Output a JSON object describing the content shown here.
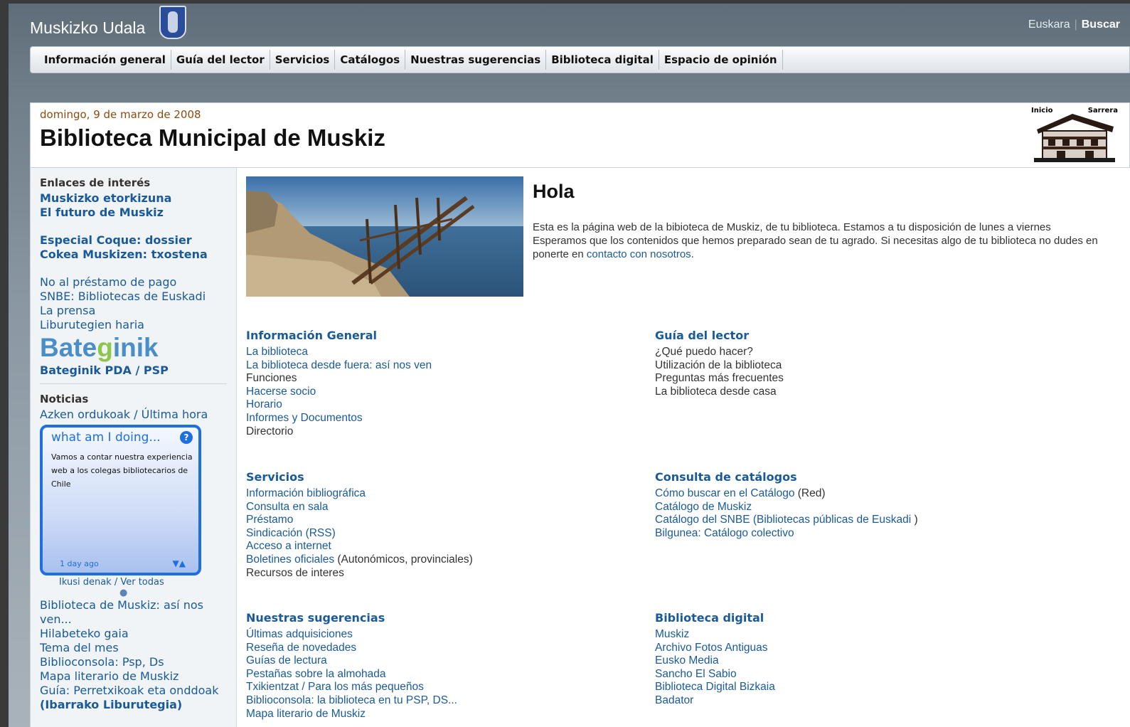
{
  "site": {
    "title": "Muskizko Udala"
  },
  "lang": {
    "euskara": "Euskara",
    "buscar": "Buscar"
  },
  "nav": [
    "Información general",
    "Guía del lector",
    "Servicios",
    "Catálogos",
    "Nuestras sugerencias",
    "Biblioteca digital",
    "Espacio de opinión"
  ],
  "header": {
    "date": "domingo, 9 de marzo de 2008",
    "heading": "Biblioteca Municipal de Muskiz",
    "logo_left": "Inicio",
    "logo_right": "Sarrera"
  },
  "sidebar": {
    "links_heading": "Enlaces de interés",
    "bold_links_1": [
      "Muskizko etorkizuna",
      "El futuro de Muskiz"
    ],
    "bold_links_2": [
      "Especial Coque: dossier",
      "Cokea Muskizen: txostena"
    ],
    "links": [
      "No al préstamo de pago",
      "SNBE: Bibliotecas de Euskadi",
      "La prensa",
      "Liburutegien haria"
    ],
    "bateginik_logo": "Bateginik",
    "bateginik_pda": "Bateginik PDA / PSP",
    "news_heading": "Noticias",
    "news_sub": "Azken ordukoak / Última hora",
    "widget": {
      "title": "what am I doing...",
      "help": "?",
      "message": "Vamos a contar nuestra experiencia web a los colegas bibliotecarios de Chile",
      "time": "1 day ago",
      "arrows": "▼▲"
    },
    "ver_todas": "Ikusi denak / Ver todas",
    "news_items": [
      "Biblioteca de Muskiz: así nos ven...",
      "Hilabeteko gaia",
      "Tema del mes",
      "Biblioconsola: Psp, Ds",
      "Mapa literario de Muskiz",
      "Guía: Perretxikoak eta onddoak"
    ],
    "news_last": "(Ibarrako Liburutegia)"
  },
  "main": {
    "hola": "Hola",
    "intro_text": "Esta es la página web de la bibioteca de Muskiz, de tu biblioteca. Estamos a tu disposición de lunes a viernes Esperamos que los contenidos que hemos preparado sean de tu agrado. Si necesitas algo de tu biblioteca no dudes en ponerte en ",
    "intro_link": "contacto con nosotros",
    "intro_end": ".",
    "info_general": {
      "title": "Información General",
      "items": [
        "La biblioteca",
        "La biblioteca desde fuera: así nos ven",
        "Funciones",
        "Hacerse socio",
        "Horario",
        "Informes y Documentos",
        "Directorio"
      ]
    },
    "guia": {
      "title": "Guía del lector",
      "items": [
        "¿Qué puedo hacer?",
        "Utilización de la biblioteca",
        "Preguntas más frecuentes",
        "La biblioteca desde casa"
      ]
    },
    "servicios": {
      "title": "Servicios",
      "items": [
        "Información bibliográfica",
        "Consulta en sala",
        "Préstamo",
        "Sindicación (RSS)",
        "Acceso a internet"
      ],
      "boletines_link": "Boletines oficiales",
      "boletines_rest": " (Autonómicos, provinciales)",
      "recursos": "Recursos de interes"
    },
    "catalogos": {
      "title": "Consulta de catálogos",
      "c1_link": "Cómo buscar en el Catálogo",
      "c1_rest": " (Red)",
      "c2": "Catálogo de Muskiz",
      "c3_link": "Catálogo del SNBE (Bibliotecas públicas de Euskadi",
      "c3_rest": " )",
      "c4": "Bilgunea: Catálogo colectivo"
    },
    "sugerencias": {
      "title": "Nuestras sugerencias",
      "items": [
        "Últimas adquisiciones",
        "Reseña de novedades",
        "Guías de lectura",
        "Pestañas sobre la almohada",
        "Txikientzat / Para los más pequeños",
        "Biblioconsola: la biblioteca en tu PSP, DS...",
        "Mapa literario de Muskiz"
      ]
    },
    "digital": {
      "title": "Biblioteca digital",
      "items": [
        "Muskiz",
        "Archivo Fotos Antiguas",
        "Eusko Media",
        "Sancho El Sabio",
        "Biblioteca Digital Bizkaia",
        "Badator"
      ]
    }
  }
}
